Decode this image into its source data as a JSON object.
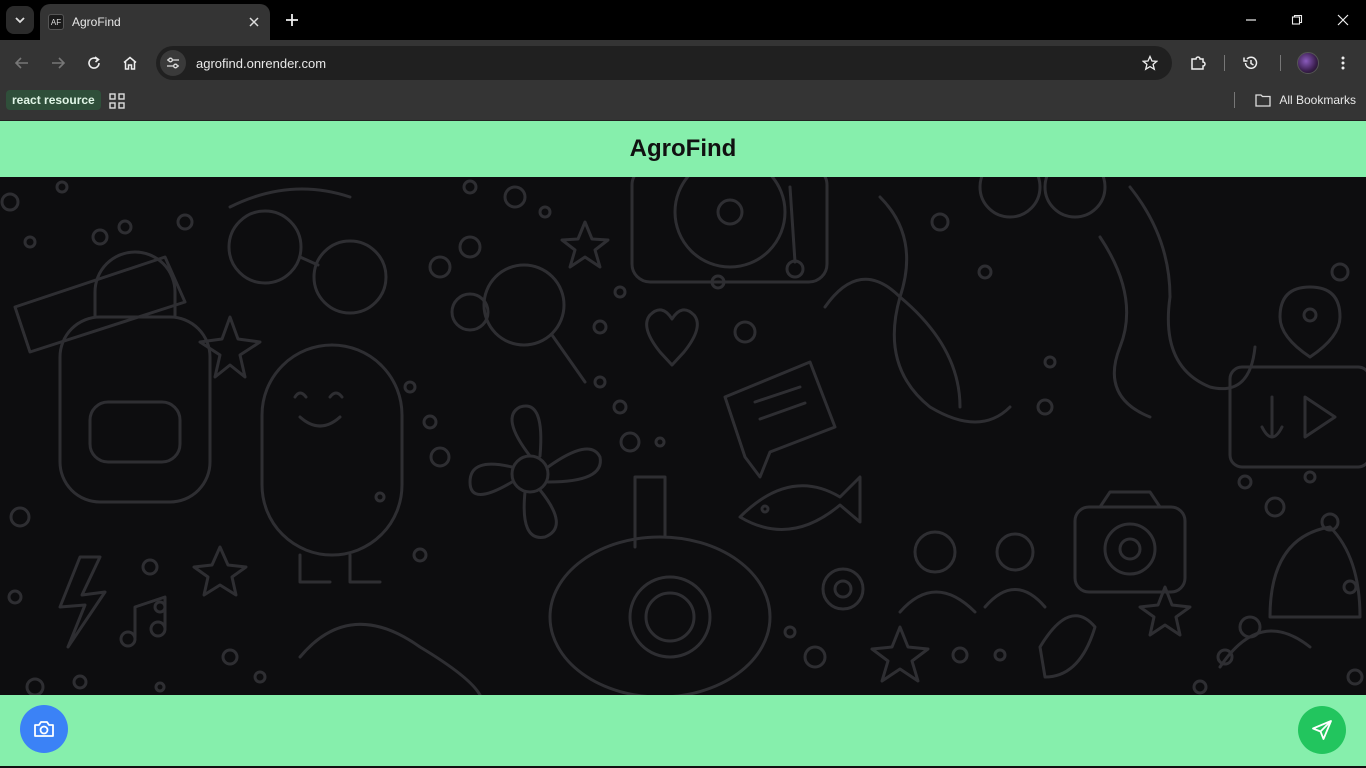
{
  "browser": {
    "tab_title": "AgroFind",
    "favicon_text": "AF",
    "url": "agrofind.onrender.com",
    "bookmarks": [
      {
        "label": "react resource"
      }
    ],
    "all_bookmarks_label": "All Bookmarks"
  },
  "app": {
    "title": "AgroFind"
  },
  "icons": {
    "tab_search": "chevron-down-icon",
    "tab_close": "close-icon",
    "new_tab": "plus-icon",
    "back": "back-arrow-icon",
    "forward": "forward-arrow-icon",
    "reload": "reload-icon",
    "home": "home-icon",
    "site_info": "tune-icon",
    "bookmark_star": "star-icon",
    "extensions": "puzzle-icon",
    "history": "history-icon",
    "menu": "kebab-menu-icon",
    "camera": "camera-icon",
    "send": "send-icon"
  },
  "colors": {
    "header_bg": "#86efac",
    "camera_btn": "#3b82f6",
    "send_btn": "#22c55e",
    "chat_bg": "#0d0d0f"
  }
}
